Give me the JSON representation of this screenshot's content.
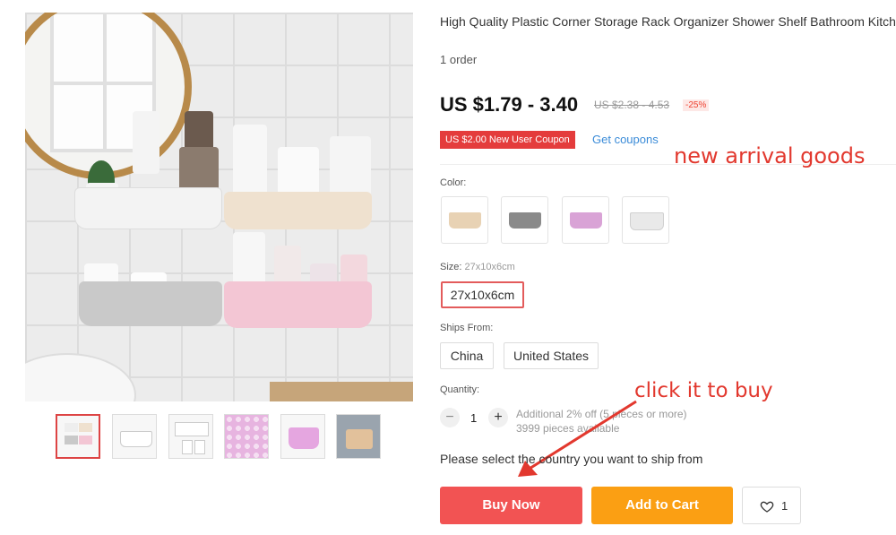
{
  "product": {
    "title": "High Quality Plastic Corner Storage Rack Organizer Shower Shelf Bathroom Kitchen Supplies Drain Rack Multifunction Storage Racks",
    "orders": "1 order",
    "price": "US $1.79 - 3.40",
    "price_original": "US $2.38 - 4.53",
    "discount": "-25%",
    "coupon": "US $2.00 New User Coupon",
    "get_coupons": "Get coupons"
  },
  "annotations": {
    "new_arrival": "new arrival goods",
    "click_to_buy": "click it to buy"
  },
  "color": {
    "label": "Color:",
    "swatches": [
      {
        "name": "beige",
        "color": "#e8d2b4"
      },
      {
        "name": "gray",
        "color": "#8a8a8a"
      },
      {
        "name": "pink",
        "color": "#d9a3d6"
      },
      {
        "name": "white",
        "color": "#e9e9e9"
      }
    ]
  },
  "size": {
    "label": "Size:",
    "selected_text": "27x10x6cm",
    "options": [
      "27x10x6cm"
    ]
  },
  "ships_from": {
    "label": "Ships From:",
    "options": [
      "China",
      "United States"
    ]
  },
  "quantity": {
    "label": "Quantity:",
    "minus": "−",
    "plus": "+",
    "value": "1",
    "offer": "Additional 2% off (5 pieces or more)",
    "available": "3999 pieces available"
  },
  "ship_note": "Please select the country you want to ship from",
  "actions": {
    "buy_now": "Buy Now",
    "add_to_cart": "Add to Cart",
    "wishlist_count": "1"
  },
  "colors": {
    "buy_now": "#f25353",
    "add_to_cart": "#fb9f13",
    "accent_red": "#e2382e",
    "link_blue": "#3a8bd8"
  }
}
